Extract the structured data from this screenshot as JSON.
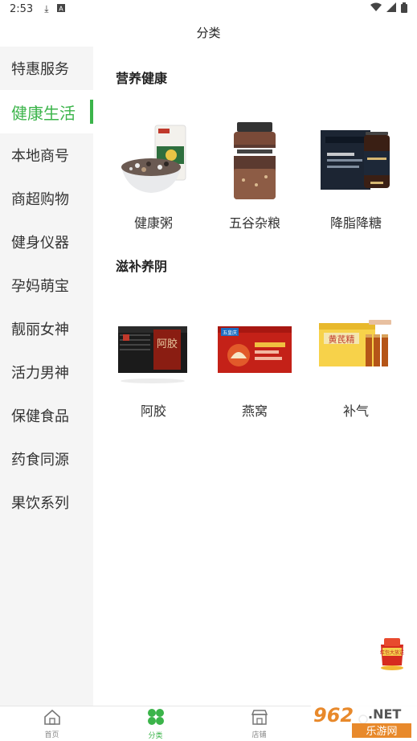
{
  "status_bar": {
    "time": "2:53"
  },
  "page": {
    "title": "分类"
  },
  "sidebar": {
    "items": [
      {
        "label": "特惠服务"
      },
      {
        "label": "健康生活",
        "active": true
      },
      {
        "label": "本地商号"
      },
      {
        "label": "商超购物"
      },
      {
        "label": "健身仪器"
      },
      {
        "label": "孕妈萌宝"
      },
      {
        "label": "靓丽女神"
      },
      {
        "label": "活力男神"
      },
      {
        "label": "保健食品"
      },
      {
        "label": "药食同源"
      },
      {
        "label": "果饮系列"
      }
    ]
  },
  "sections": [
    {
      "title": "营养健康",
      "items": [
        {
          "label": "健康粥"
        },
        {
          "label": "五谷杂粮"
        },
        {
          "label": "降脂降糖"
        }
      ]
    },
    {
      "title": "滋补养阴",
      "items": [
        {
          "label": "阿胶"
        },
        {
          "label": "燕窝"
        },
        {
          "label": "补气"
        }
      ]
    }
  ],
  "product_text": {
    "ejiao_box": "阿胶",
    "bird_nest_brand": "五皇庆",
    "huangqi_box": "黄芪精",
    "fab_text": "红包大放送"
  },
  "bottom_nav": {
    "items": [
      {
        "label": "首页"
      },
      {
        "label": "分类",
        "active": true
      },
      {
        "label": "店铺"
      },
      {
        "label": ""
      }
    ]
  },
  "watermark": {
    "number": "962",
    "suffix": ".NET",
    "name": "乐游网"
  },
  "colors": {
    "accent": "#3bb44a",
    "sidebar_bg": "#f5f5f5"
  }
}
